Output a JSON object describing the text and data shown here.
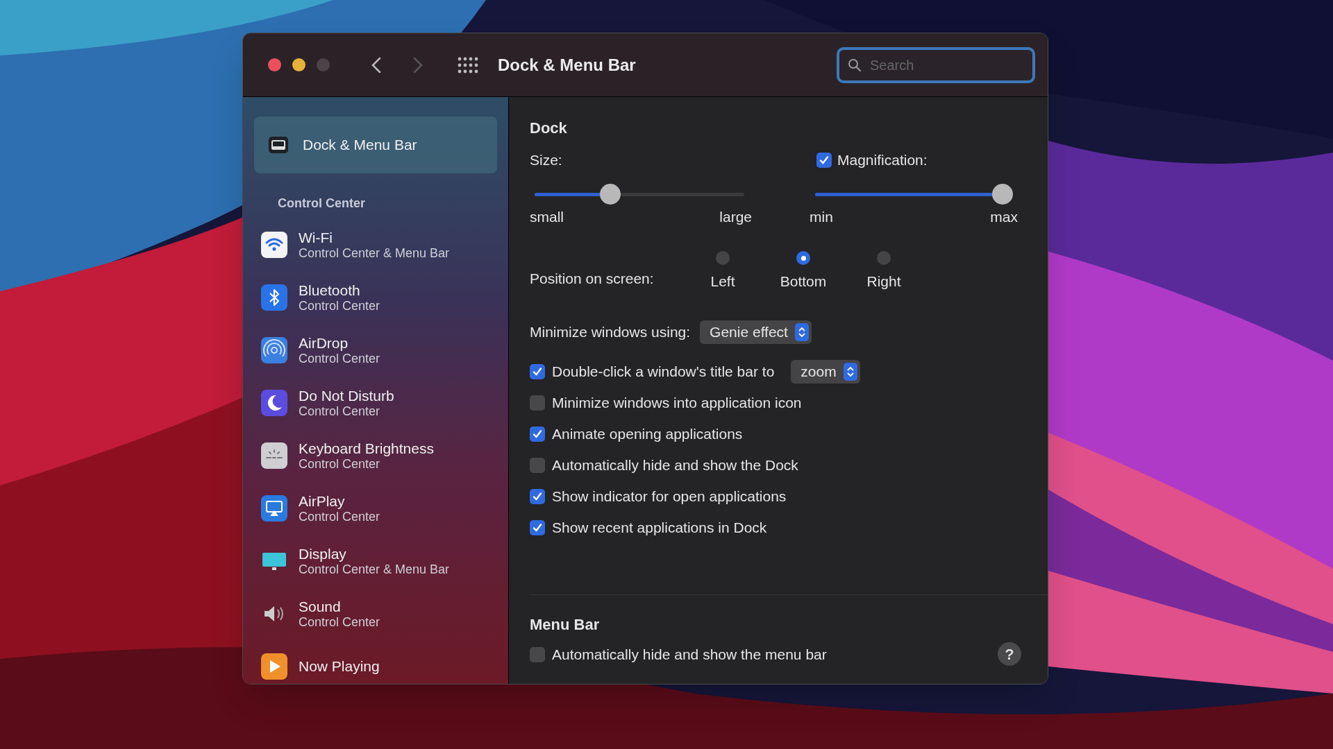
{
  "window": {
    "title": "Dock & Menu Bar"
  },
  "toolbar": {
    "search": {
      "placeholder": "Search"
    }
  },
  "sidebar": {
    "items": [
      {
        "title": "Dock & Menu Bar",
        "selected": true
      }
    ],
    "section": {
      "title": "Control Center",
      "items": [
        {
          "title": "Wi-Fi",
          "subtitle": "Control Center & Menu Bar",
          "selected": false
        },
        {
          "title": "Bluetooth",
          "subtitle": "Control Center",
          "selected": false
        },
        {
          "title": "AirDrop",
          "subtitle": "Control Center",
          "selected": false
        },
        {
          "title": "Do Not Disturb",
          "subtitle": "Control Center",
          "selected": false
        },
        {
          "title": "Keyboard Brightness",
          "subtitle": "Control Center",
          "selected": false
        },
        {
          "title": "AirPlay",
          "subtitle": "Control Center",
          "selected": false
        },
        {
          "title": "Display",
          "subtitle": "Control Center & Menu Bar",
          "selected": false
        },
        {
          "title": "Sound",
          "subtitle": "Control Center",
          "selected": false
        },
        {
          "title": "Now Playing",
          "selected": false
        }
      ]
    }
  },
  "dock": {
    "title": "Dock",
    "size": {
      "label": "Size:",
      "level": 0.36,
      "min_label": "small",
      "max_label": "large"
    },
    "magnification": {
      "label": "Magnification:",
      "checked": true,
      "level": 1.0,
      "min_label": "min",
      "max_label": "max"
    },
    "position": {
      "label": "Position on screen:",
      "options": [
        {
          "label": "Left",
          "selected": false
        },
        {
          "label": "Bottom",
          "selected": true
        },
        {
          "label": "Right",
          "selected": false
        }
      ]
    },
    "minimize": {
      "label": "Minimize windows using:",
      "value": "Genie effect"
    },
    "options": [
      {
        "label": "Double-click a window's title bar to",
        "checked": true,
        "popup": "zoom"
      },
      {
        "label": "Minimize windows into application icon",
        "checked": false
      },
      {
        "label": "Animate opening applications",
        "checked": true
      },
      {
        "label": "Automatically hide and show the Dock",
        "checked": false
      },
      {
        "label": "Show indicator for open applications",
        "checked": true
      },
      {
        "label": "Show recent applications in Dock",
        "checked": true
      }
    ]
  },
  "menu_bar": {
    "title": "Menu Bar",
    "options": [
      {
        "label": "Automatically hide and show the menu bar",
        "checked": false
      }
    ],
    "help": "?"
  }
}
